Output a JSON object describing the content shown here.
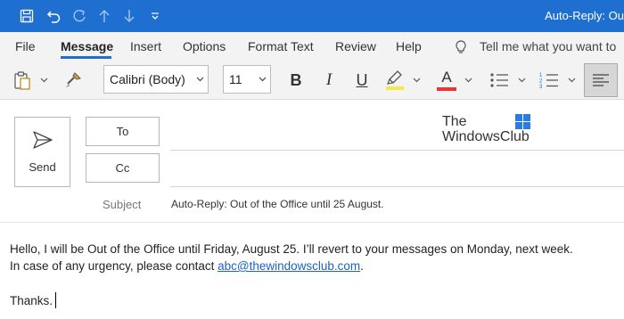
{
  "window": {
    "title": "Auto-Reply: Ou"
  },
  "quick_access": {
    "save_icon": "save-icon",
    "undo_icon": "undo-icon",
    "redo_icon": "redo-icon",
    "up_icon": "arrow-up-icon",
    "down_icon": "arrow-down-icon",
    "customize_icon": "customize-quick-access-icon"
  },
  "menu": {
    "items": [
      "File",
      "Message",
      "Insert",
      "Options",
      "Format Text",
      "Review",
      "Help"
    ],
    "active": "Message",
    "tell_me": "Tell me what you want to"
  },
  "ribbon": {
    "font_name": "Calibri (Body)",
    "font_size": "11",
    "bold": "B",
    "italic": "I",
    "underline": "U",
    "highlight_color": "#f5e94a",
    "font_color": "#e53935",
    "font_color_letter": "A"
  },
  "compose": {
    "send_label": "Send",
    "to_label": "To",
    "cc_label": "Cc",
    "subject_label": "Subject",
    "subject_value": "Auto-Reply: Out of the Office until 25 August."
  },
  "watermark": {
    "line1": "The",
    "line2": "WindowsClub"
  },
  "message_body": {
    "line1": "Hello, I will be Out of the Office until Friday, August 25. I’ll revert to your messages on Monday, next week.",
    "line2_prefix": "In case of any urgency, please contact ",
    "line2_link": "abc@thewindowsclub.com",
    "line2_suffix": ".",
    "line3": "Thanks."
  },
  "colors": {
    "accent": "#1e6fd0",
    "link": "#1a63c7"
  }
}
